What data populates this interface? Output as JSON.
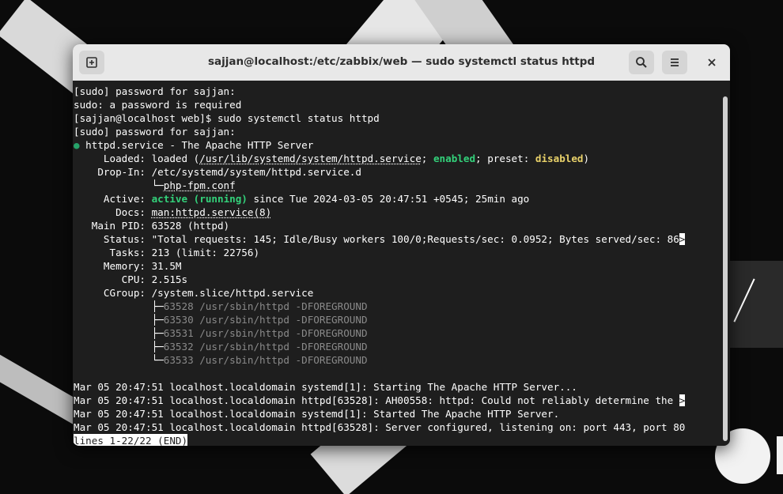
{
  "window": {
    "title": "sajjan@localhost:/etc/zabbix/web — sudo systemctl status httpd",
    "new_tab_icon": "new-tab-icon",
    "search_icon": "search-icon",
    "menu_icon": "hamburger-menu-icon",
    "close_icon": "close-icon"
  },
  "terminal": {
    "l1": "[sudo] password for sajjan:",
    "l2": "sudo: a password is required",
    "l3": "[sajjan@localhost web]$ sudo systemctl status httpd",
    "l4": "[sudo] password for sajjan:",
    "l5_bullet": "●",
    "l5_text": " httpd.service - The Apache HTTP Server",
    "l6_pre": "     Loaded: loaded (",
    "l6_path": "/usr/lib/systemd/system/httpd.service",
    "l6_mid": "; ",
    "l6_enabled": "enabled",
    "l6_mid2": "; preset: ",
    "l6_disabled": "disabled",
    "l6_end": ")",
    "l7": "    Drop-In: /etc/systemd/system/httpd.service.d",
    "l8_pre": "             └─",
    "l8_file": "php-fpm.conf",
    "l9_pre": "     Active: ",
    "l9_state": "active (running)",
    "l9_rest": " since Tue 2024-03-05 20:47:51 +0545; 25min ago",
    "l10_pre": "       Docs: ",
    "l10_link": "man:httpd.service(8)",
    "l11": "   Main PID: 63528 (httpd)",
    "l12": "     Status: \"Total requests: 145; Idle/Busy workers 100/0;Requests/sec: 0.0952; Bytes served/sec: 86",
    "l13": "      Tasks: 213 (limit: 22756)",
    "l14": "     Memory: 31.5M",
    "l15": "        CPU: 2.515s",
    "l16": "     CGroup: /system.slice/httpd.service",
    "cgroup_tree": "             ├─",
    "cgroup_last": "             └─",
    "c1": "63528 /usr/sbin/httpd -DFOREGROUND",
    "c2": "63530 /usr/sbin/httpd -DFOREGROUND",
    "c3": "63531 /usr/sbin/httpd -DFOREGROUND",
    "c4": "63532 /usr/sbin/httpd -DFOREGROUND",
    "c5": "63533 /usr/sbin/httpd -DFOREGROUND",
    "j1": "Mar 05 20:47:51 localhost.localdomain systemd[1]: Starting The Apache HTTP Server...",
    "j2": "Mar 05 20:47:51 localhost.localdomain httpd[63528]: AH00558: httpd: Could not reliably determine the ",
    "j3": "Mar 05 20:47:51 localhost.localdomain systemd[1]: Started The Apache HTTP Server.",
    "j4": "Mar 05 20:47:51 localhost.localdomain httpd[63528]: Server configured, listening on: port 443, port 80",
    "truncation_marker": ">",
    "pager_status": "lines 1-22/22 (END)"
  }
}
